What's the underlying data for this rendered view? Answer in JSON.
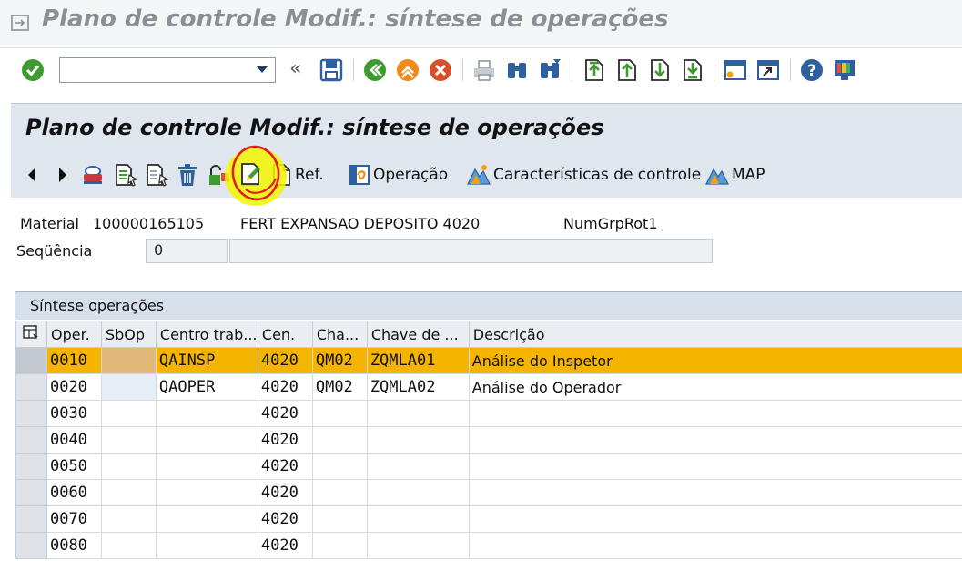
{
  "window": {
    "title": "Plano de controle Modif.: síntese de operações"
  },
  "toolbar": {
    "command_value": "",
    "icons": [
      "enter-icon",
      "save-icon",
      "back-icon",
      "exit-icon",
      "cancel-icon",
      "print-icon",
      "find-icon",
      "find-next-icon",
      "first-page-icon",
      "previous-page-icon",
      "next-page-icon",
      "last-page-icon",
      "create-session-icon",
      "shortcut-icon",
      "help-icon",
      "customize-layout-icon"
    ]
  },
  "screen": {
    "title": "Plano de controle Modif.: síntese de operações"
  },
  "app_toolbar": {
    "ref_label": "Ref.",
    "operacao_label": "Operação",
    "caracteristicas_label": "Características de controle",
    "map_label": "MAP"
  },
  "header": {
    "material_label": "Material",
    "material_value": "100000165105",
    "material_desc": "FERT EXPANSAO DEPOSITO 4020",
    "grp_label": "NumGrpRot1",
    "sequencia_label": "Seqüência",
    "sequencia_value": "0",
    "sequencia_desc": ""
  },
  "table": {
    "title": "Síntese operações",
    "columns": [
      "Oper.",
      "SbOp",
      "Centro trab...",
      "Cen.",
      "Cha...",
      "Chave de ...",
      "Descrição"
    ],
    "rows": [
      {
        "oper": "0010",
        "sbop": "",
        "centro": "QAINSP",
        "cen": "4020",
        "cha": "QM02",
        "chave": "ZQMLA01",
        "desc": "Análise do Inspetor"
      },
      {
        "oper": "0020",
        "sbop": "",
        "centro": "QAOPER",
        "cen": "4020",
        "cha": "QM02",
        "chave": "ZQMLA02",
        "desc": "Análise do Operador"
      },
      {
        "oper": "0030",
        "sbop": "",
        "centro": "",
        "cen": "4020",
        "cha": "",
        "chave": "",
        "desc": ""
      },
      {
        "oper": "0040",
        "sbop": "",
        "centro": "",
        "cen": "4020",
        "cha": "",
        "chave": "",
        "desc": ""
      },
      {
        "oper": "0050",
        "sbop": "",
        "centro": "",
        "cen": "4020",
        "cha": "",
        "chave": "",
        "desc": ""
      },
      {
        "oper": "0060",
        "sbop": "",
        "centro": "",
        "cen": "4020",
        "cha": "",
        "chave": "",
        "desc": ""
      },
      {
        "oper": "0070",
        "sbop": "",
        "centro": "",
        "cen": "4020",
        "cha": "",
        "chave": "",
        "desc": ""
      },
      {
        "oper": "0080",
        "sbop": "",
        "centro": "",
        "cen": "4020",
        "cha": "",
        "chave": "",
        "desc": ""
      }
    ],
    "active_row": 0
  },
  "colors": {
    "active_row": "#f5b400",
    "header_band": "#dfe6ee",
    "annotation_circle": "#e0201f",
    "annotation_highlight": "#f3f500"
  }
}
